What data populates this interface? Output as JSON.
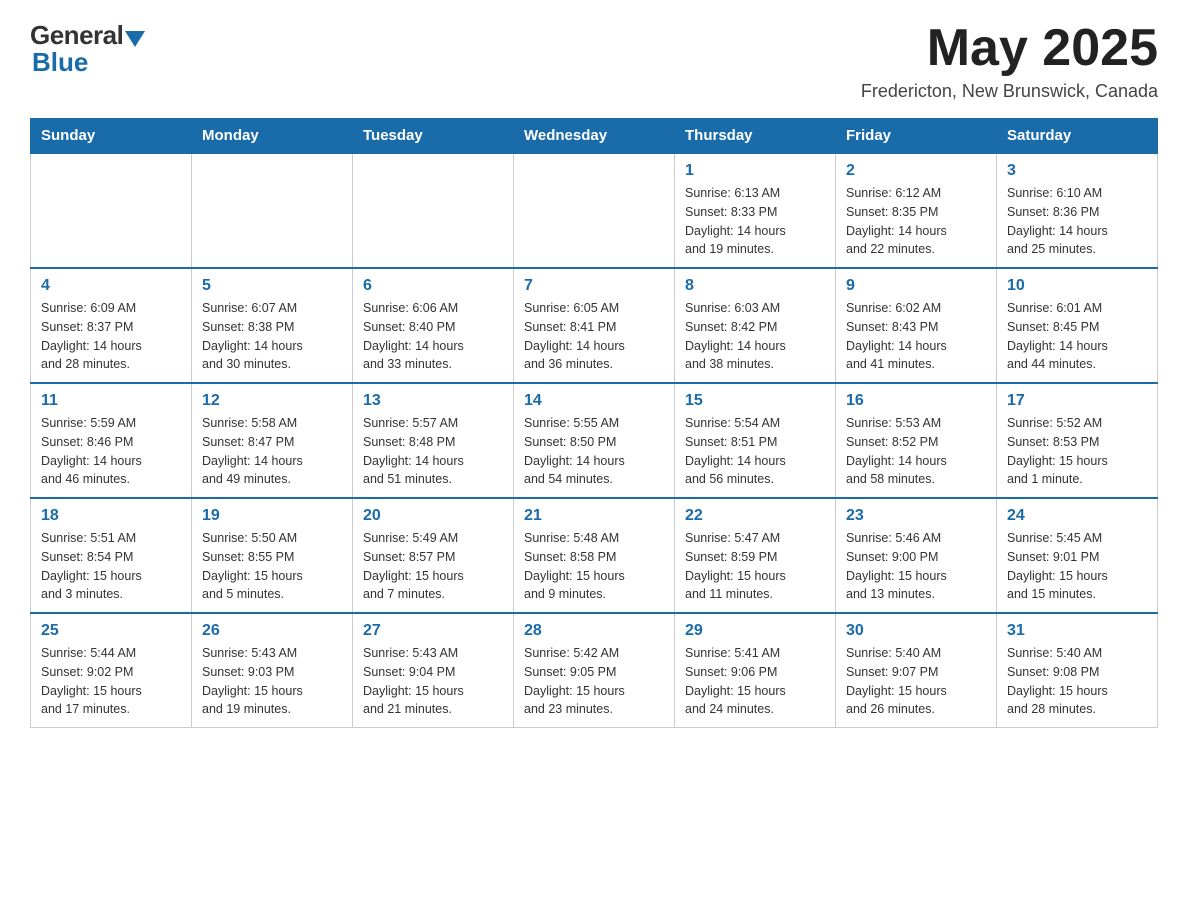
{
  "header": {
    "logo_general": "General",
    "logo_blue": "Blue",
    "month_title": "May 2025",
    "location": "Fredericton, New Brunswick, Canada"
  },
  "days_of_week": [
    "Sunday",
    "Monday",
    "Tuesday",
    "Wednesday",
    "Thursday",
    "Friday",
    "Saturday"
  ],
  "weeks": [
    [
      {
        "day": "",
        "info": ""
      },
      {
        "day": "",
        "info": ""
      },
      {
        "day": "",
        "info": ""
      },
      {
        "day": "",
        "info": ""
      },
      {
        "day": "1",
        "info": "Sunrise: 6:13 AM\nSunset: 8:33 PM\nDaylight: 14 hours\nand 19 minutes."
      },
      {
        "day": "2",
        "info": "Sunrise: 6:12 AM\nSunset: 8:35 PM\nDaylight: 14 hours\nand 22 minutes."
      },
      {
        "day": "3",
        "info": "Sunrise: 6:10 AM\nSunset: 8:36 PM\nDaylight: 14 hours\nand 25 minutes."
      }
    ],
    [
      {
        "day": "4",
        "info": "Sunrise: 6:09 AM\nSunset: 8:37 PM\nDaylight: 14 hours\nand 28 minutes."
      },
      {
        "day": "5",
        "info": "Sunrise: 6:07 AM\nSunset: 8:38 PM\nDaylight: 14 hours\nand 30 minutes."
      },
      {
        "day": "6",
        "info": "Sunrise: 6:06 AM\nSunset: 8:40 PM\nDaylight: 14 hours\nand 33 minutes."
      },
      {
        "day": "7",
        "info": "Sunrise: 6:05 AM\nSunset: 8:41 PM\nDaylight: 14 hours\nand 36 minutes."
      },
      {
        "day": "8",
        "info": "Sunrise: 6:03 AM\nSunset: 8:42 PM\nDaylight: 14 hours\nand 38 minutes."
      },
      {
        "day": "9",
        "info": "Sunrise: 6:02 AM\nSunset: 8:43 PM\nDaylight: 14 hours\nand 41 minutes."
      },
      {
        "day": "10",
        "info": "Sunrise: 6:01 AM\nSunset: 8:45 PM\nDaylight: 14 hours\nand 44 minutes."
      }
    ],
    [
      {
        "day": "11",
        "info": "Sunrise: 5:59 AM\nSunset: 8:46 PM\nDaylight: 14 hours\nand 46 minutes."
      },
      {
        "day": "12",
        "info": "Sunrise: 5:58 AM\nSunset: 8:47 PM\nDaylight: 14 hours\nand 49 minutes."
      },
      {
        "day": "13",
        "info": "Sunrise: 5:57 AM\nSunset: 8:48 PM\nDaylight: 14 hours\nand 51 minutes."
      },
      {
        "day": "14",
        "info": "Sunrise: 5:55 AM\nSunset: 8:50 PM\nDaylight: 14 hours\nand 54 minutes."
      },
      {
        "day": "15",
        "info": "Sunrise: 5:54 AM\nSunset: 8:51 PM\nDaylight: 14 hours\nand 56 minutes."
      },
      {
        "day": "16",
        "info": "Sunrise: 5:53 AM\nSunset: 8:52 PM\nDaylight: 14 hours\nand 58 minutes."
      },
      {
        "day": "17",
        "info": "Sunrise: 5:52 AM\nSunset: 8:53 PM\nDaylight: 15 hours\nand 1 minute."
      }
    ],
    [
      {
        "day": "18",
        "info": "Sunrise: 5:51 AM\nSunset: 8:54 PM\nDaylight: 15 hours\nand 3 minutes."
      },
      {
        "day": "19",
        "info": "Sunrise: 5:50 AM\nSunset: 8:55 PM\nDaylight: 15 hours\nand 5 minutes."
      },
      {
        "day": "20",
        "info": "Sunrise: 5:49 AM\nSunset: 8:57 PM\nDaylight: 15 hours\nand 7 minutes."
      },
      {
        "day": "21",
        "info": "Sunrise: 5:48 AM\nSunset: 8:58 PM\nDaylight: 15 hours\nand 9 minutes."
      },
      {
        "day": "22",
        "info": "Sunrise: 5:47 AM\nSunset: 8:59 PM\nDaylight: 15 hours\nand 11 minutes."
      },
      {
        "day": "23",
        "info": "Sunrise: 5:46 AM\nSunset: 9:00 PM\nDaylight: 15 hours\nand 13 minutes."
      },
      {
        "day": "24",
        "info": "Sunrise: 5:45 AM\nSunset: 9:01 PM\nDaylight: 15 hours\nand 15 minutes."
      }
    ],
    [
      {
        "day": "25",
        "info": "Sunrise: 5:44 AM\nSunset: 9:02 PM\nDaylight: 15 hours\nand 17 minutes."
      },
      {
        "day": "26",
        "info": "Sunrise: 5:43 AM\nSunset: 9:03 PM\nDaylight: 15 hours\nand 19 minutes."
      },
      {
        "day": "27",
        "info": "Sunrise: 5:43 AM\nSunset: 9:04 PM\nDaylight: 15 hours\nand 21 minutes."
      },
      {
        "day": "28",
        "info": "Sunrise: 5:42 AM\nSunset: 9:05 PM\nDaylight: 15 hours\nand 23 minutes."
      },
      {
        "day": "29",
        "info": "Sunrise: 5:41 AM\nSunset: 9:06 PM\nDaylight: 15 hours\nand 24 minutes."
      },
      {
        "day": "30",
        "info": "Sunrise: 5:40 AM\nSunset: 9:07 PM\nDaylight: 15 hours\nand 26 minutes."
      },
      {
        "day": "31",
        "info": "Sunrise: 5:40 AM\nSunset: 9:08 PM\nDaylight: 15 hours\nand 28 minutes."
      }
    ]
  ]
}
